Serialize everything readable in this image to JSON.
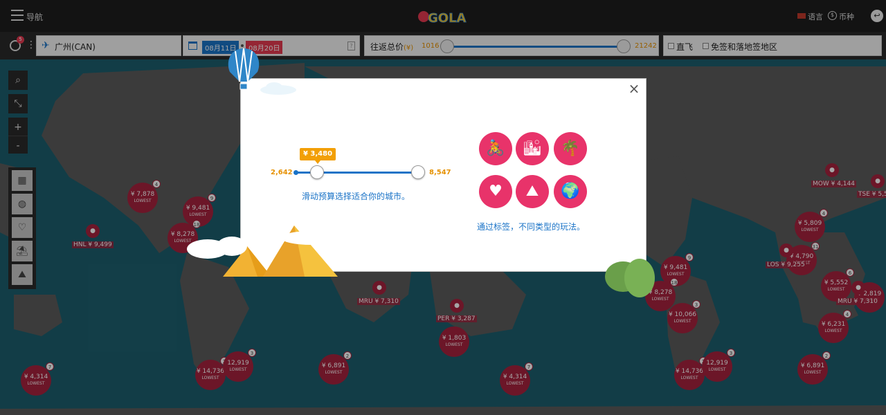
{
  "navbar": {
    "nav_label": "导航",
    "logo_text": "GOLA",
    "language_label": "语言",
    "currency_label": "币种"
  },
  "search": {
    "history_badge": "5",
    "origin": "广州(CAN)",
    "depart_date": "08月11日",
    "return_date": "08月20日",
    "price_label": "往返总价",
    "price_currency": "(¥)",
    "price_min": "1016",
    "price_max": "21242",
    "direct_label": "直飞",
    "visa_label": "免签和落地签地区"
  },
  "map": {
    "bubbles": [
      {
        "price": "¥ 7,878",
        "lowest": "LOWEST",
        "count": "4"
      },
      {
        "price": "¥ 9,481",
        "lowest": "LOWEST",
        "count": "9"
      },
      {
        "price": "¥ 8,278",
        "lowest": "LOWEST",
        "count": "18"
      },
      {
        "price": "¥ 4,314",
        "lowest": "LOWEST",
        "count": "7"
      },
      {
        "price": "¥ 14,736",
        "lowest": "LOWEST",
        "count": "2"
      },
      {
        "price": "12,919",
        "lowest": "LOWEST",
        "count": "3"
      },
      {
        "price": "¥ 6,891",
        "lowest": "LOWEST",
        "count": "2"
      },
      {
        "price": "¥ 1,803",
        "lowest": "LOWEST",
        "count": ""
      },
      {
        "price": "¥ 4,314",
        "lowest": "LOWEST",
        "count": "7"
      },
      {
        "price": "¥ 9,481",
        "lowest": "LOWEST",
        "count": "9"
      },
      {
        "price": "¥ 8,278",
        "lowest": "LOWEST",
        "count": "18"
      },
      {
        "price": "¥ 10,066",
        "lowest": "LOWEST",
        "count": "3"
      },
      {
        "price": "¥ 14,736",
        "lowest": "LOWEST",
        "count": "2"
      },
      {
        "price": "12,919",
        "lowest": "LOWEST",
        "count": "3"
      },
      {
        "price": "¥ 5,809",
        "lowest": "LOWEST",
        "count": "4"
      },
      {
        "price": "¥ 4,790",
        "lowest": "LOWEST",
        "count": "31"
      },
      {
        "price": "¥ 5,552",
        "lowest": "LOWEST",
        "count": "6"
      },
      {
        "price": "¥ 6,231",
        "lowest": "LOWEST",
        "count": "4"
      },
      {
        "price": "¥ 6,891",
        "lowest": "LOWEST",
        "count": "2"
      },
      {
        "price": "¥ 2,819",
        "lowest": "LOWEST",
        "count": ""
      }
    ],
    "pins": [
      {
        "label": "HNL ¥ 9,499"
      },
      {
        "label": "MRU ¥ 7,310"
      },
      {
        "label": "PER ¥ 3,287"
      },
      {
        "label": "LOS ¥ 9,255"
      },
      {
        "label": "MOW ¥ 4,144"
      },
      {
        "label": "TSE ¥ 5,5"
      },
      {
        "label": "MRU ¥ 7,310"
      }
    ],
    "tools": {
      "zoom_in": "+",
      "zoom_out": "-"
    }
  },
  "modal": {
    "budget_tooltip": "¥ 3,480",
    "budget_min": "2,642",
    "budget_max": "8,547",
    "budget_caption": "滑动预算选择适合你的城市。",
    "tags_caption": "通过标签，不同类型的玩法。",
    "tags": [
      {
        "icon": "cycling-icon",
        "glyph": "🚴"
      },
      {
        "icon": "city-icon",
        "glyph": "🏙"
      },
      {
        "icon": "beach-icon",
        "glyph": "🌴"
      },
      {
        "icon": "romance-icon",
        "glyph": "♥"
      },
      {
        "icon": "nature-icon",
        "glyph": "⛰"
      },
      {
        "icon": "culture-icon",
        "glyph": "🌍"
      }
    ],
    "close_label": "×"
  },
  "colors": {
    "accent_blue": "#1a73c7",
    "accent_orange": "#f29f05",
    "tag_pink": "#e8336a",
    "bubble_red": "#a6233e",
    "map_sea": "#1d5f6e"
  }
}
